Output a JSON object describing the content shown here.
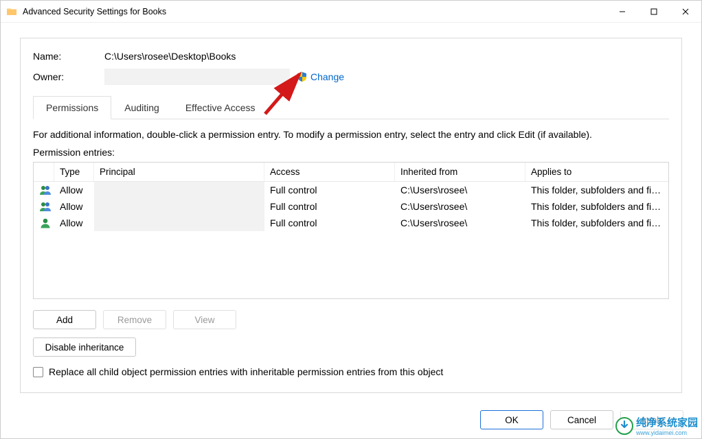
{
  "window": {
    "title": "Advanced Security Settings for Books"
  },
  "fields": {
    "name_label": "Name:",
    "name_value": "C:\\Users\\rosee\\Desktop\\Books",
    "owner_label": "Owner:",
    "owner_value": "",
    "change_link": "Change"
  },
  "tabs": {
    "permissions": "Permissions",
    "auditing": "Auditing",
    "effective": "Effective Access"
  },
  "info_text": "For additional information, double-click a permission entry. To modify a permission entry, select the entry and click Edit (if available).",
  "pe_label": "Permission entries:",
  "columns": {
    "type": "Type",
    "principal": "Principal",
    "access": "Access",
    "inherited": "Inherited from",
    "applies": "Applies to"
  },
  "rows": [
    {
      "icon": "group",
      "type": "Allow",
      "principal": "",
      "access": "Full control",
      "inherited": "C:\\Users\\rosee\\",
      "applies": "This folder, subfolders and files"
    },
    {
      "icon": "group",
      "type": "Allow",
      "principal": "",
      "access": "Full control",
      "inherited": "C:\\Users\\rosee\\",
      "applies": "This folder, subfolders and files"
    },
    {
      "icon": "user",
      "type": "Allow",
      "principal": "",
      "access": "Full control",
      "inherited": "C:\\Users\\rosee\\",
      "applies": "This folder, subfolders and files"
    }
  ],
  "buttons": {
    "add": "Add",
    "remove": "Remove",
    "view": "View",
    "disable_inh": "Disable inheritance",
    "ok": "OK",
    "cancel": "Cancel",
    "apply": "Apply"
  },
  "checkbox": {
    "replace": "Replace all child object permission entries with inheritable permission entries from this object"
  },
  "watermark": {
    "text": "纯净系统家园",
    "url": "www.yidaimei.com"
  }
}
